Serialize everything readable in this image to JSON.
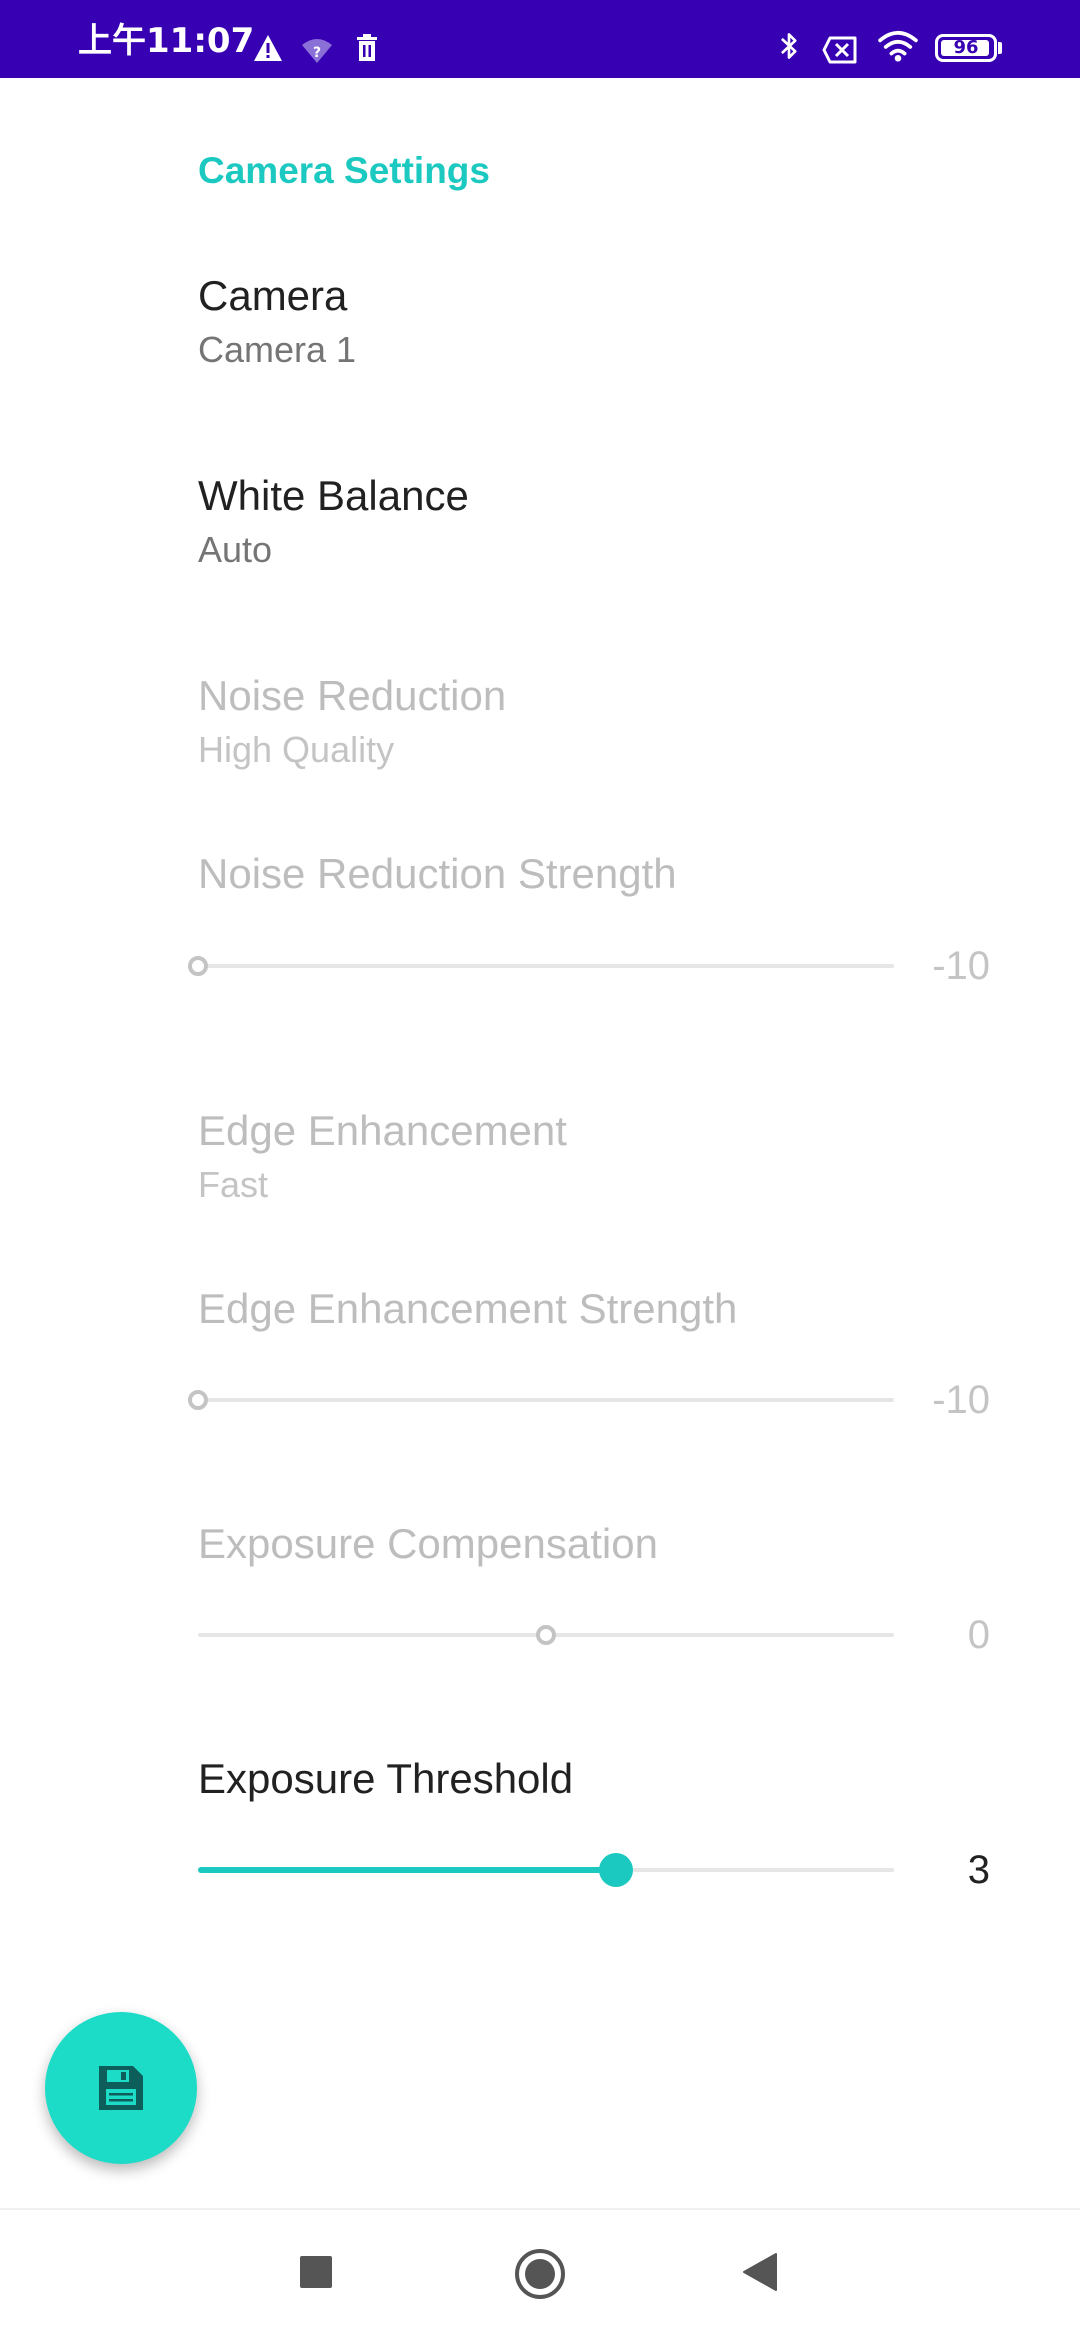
{
  "status_bar": {
    "time": "上午11:07",
    "battery_level": "96",
    "battery_fraction": 0.96,
    "icons": [
      "warning-icon",
      "wifi-question-icon",
      "trash-icon",
      "bluetooth-icon",
      "sim-off-icon",
      "wifi-icon",
      "battery-icon"
    ]
  },
  "settings": {
    "category_title": "Camera Settings",
    "camera": {
      "title": "Camera",
      "summary": "Camera 1"
    },
    "white_balance": {
      "title": "White Balance",
      "summary": "Auto"
    },
    "noise_reduction": {
      "title": "Noise Reduction",
      "summary": "High Quality"
    },
    "noise_reduction_strength": {
      "title": "Noise Reduction Strength",
      "value": "-10",
      "fraction": 0.0
    },
    "edge_enhancement": {
      "title": "Edge Enhancement",
      "summary": "Fast"
    },
    "edge_enhancement_strength": {
      "title": "Edge Enhancement Strength",
      "value": "-10",
      "fraction": 0.0
    },
    "exposure_compensation": {
      "title": "Exposure Compensation",
      "value": "0",
      "fraction": 0.5
    },
    "exposure_threshold": {
      "title": "Exposure Threshold",
      "value": "3",
      "fraction": 0.6
    }
  },
  "fab": {
    "icon": "save-icon"
  },
  "nav_bar": {
    "icons": [
      "recents-icon",
      "home-icon",
      "back-icon"
    ]
  },
  "colors": {
    "status_bar": "#3700b3",
    "accent": "#1cc9c0",
    "fab": "#1cdcc8"
  }
}
